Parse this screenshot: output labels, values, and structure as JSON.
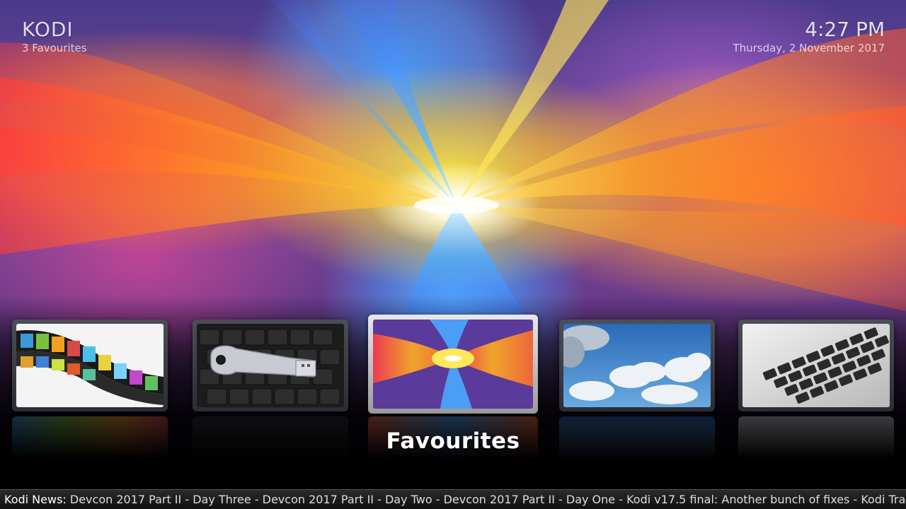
{
  "header": {
    "app_title": "KODI",
    "subtitle": "3 Favourites",
    "time": "4:27 PM",
    "date": "Thursday, 2 November 2017"
  },
  "tiles": [
    {
      "name": "film-strip",
      "icon": "film-strip-image"
    },
    {
      "name": "usb-key",
      "icon": "usb-key-on-keyboard-image"
    },
    {
      "name": "favourites",
      "icon": "abstract-swirl-image",
      "focused": true
    },
    {
      "name": "sky-clouds",
      "icon": "cloudy-sky-image"
    },
    {
      "name": "laptop-keyboard",
      "icon": "laptop-keyboard-image"
    }
  ],
  "focused_label": "Favourites",
  "ticker": {
    "label": "Kodi News:",
    "text": " Devcon 2017 Part II - Day Three - Devcon 2017 Part II - Day Two - Devcon 2017 Part II - Day One - Kodi v17.5 final: Another bunch of fixes - Kodi Trademark Tro"
  },
  "colors": {
    "accent_orange": "#ff7a2a",
    "accent_blue": "#4aa8ff",
    "accent_yellow": "#ffe63c",
    "ticker_bg": "#1a1a1a"
  }
}
